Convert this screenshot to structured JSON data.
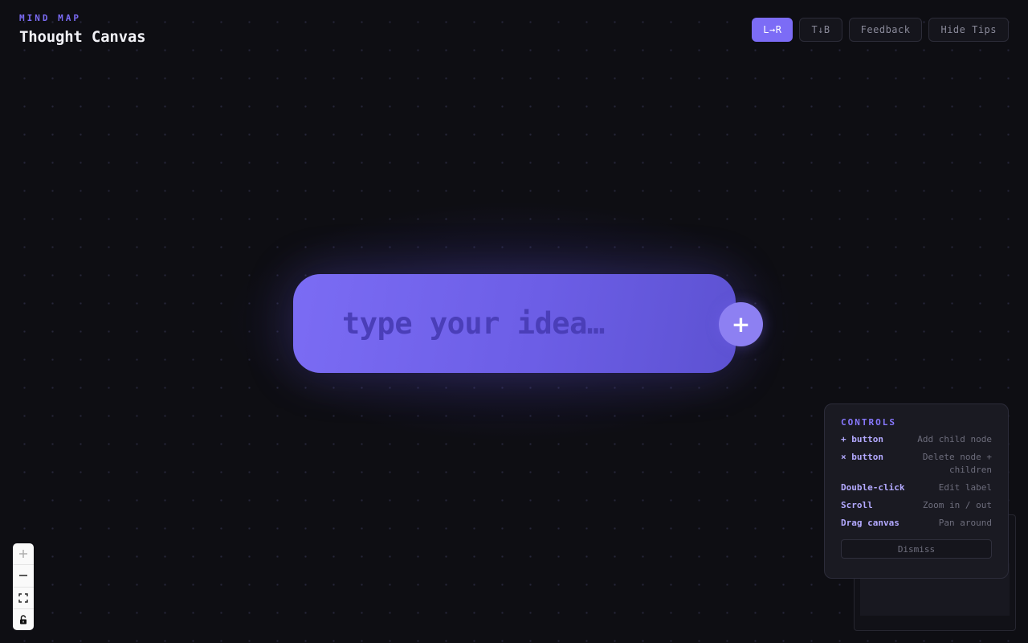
{
  "header": {
    "eyebrow": "MIND MAP",
    "title": "Thought Canvas"
  },
  "toolbar": {
    "layout_lr_label": "L→R",
    "layout_tb_label": "T↓B",
    "feedback_label": "Feedback",
    "hide_tips_label": "Hide Tips",
    "active_layout": "L→R"
  },
  "node": {
    "placeholder": "type your idea…",
    "value": "",
    "add_child_icon": "plus-icon",
    "add_child_label": "+"
  },
  "controls": {
    "title": "CONTROLS",
    "rows": [
      {
        "key": "+ button",
        "desc": "Add child node"
      },
      {
        "key": "× button",
        "desc": "Delete node + children"
      },
      {
        "key": "Double-click",
        "desc": "Edit label"
      },
      {
        "key": "Scroll",
        "desc": "Zoom in / out"
      },
      {
        "key": "Drag canvas",
        "desc": "Pan around"
      }
    ],
    "dismiss_label": "Dismiss"
  },
  "zoom_controls": {
    "icons": [
      "zoom-in-icon",
      "zoom-out-icon",
      "fit-view-icon",
      "lock-icon"
    ]
  },
  "colors": {
    "accent": "#7c6cf6",
    "background": "#0e0e13",
    "node_fill": "#7b6cf4"
  }
}
